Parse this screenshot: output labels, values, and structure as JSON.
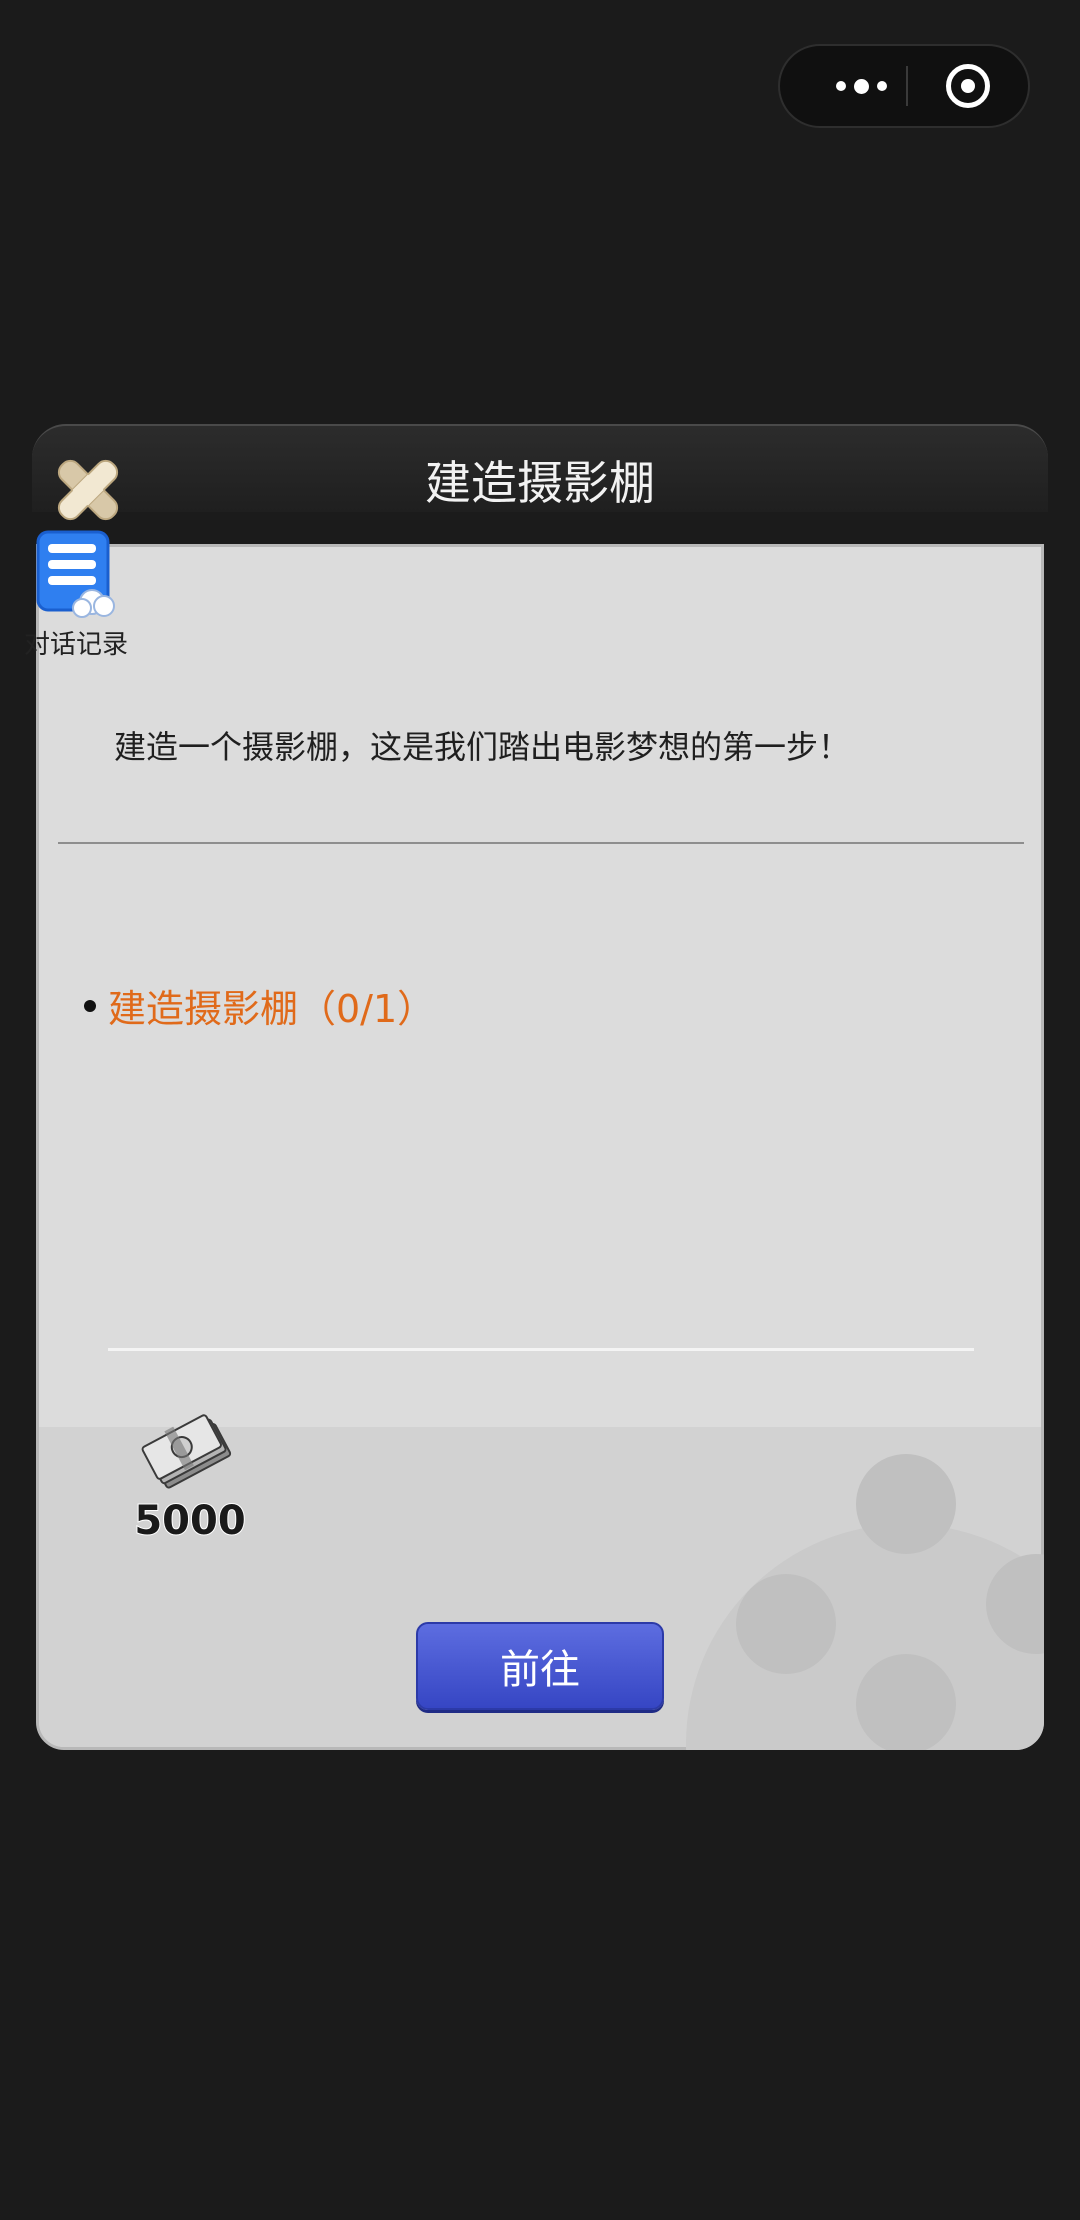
{
  "capsule": {
    "more_icon": "more-dots-icon",
    "close_icon": "target-circle-icon"
  },
  "dialog": {
    "title": "建造摄影棚",
    "close_icon": "close-x-icon",
    "chat_log": {
      "icon": "chat-log-icon",
      "label": "对话记录"
    },
    "description": "建造一个摄影棚，这是我们踏出电影梦想的第一步！",
    "objective": {
      "text": "建造摄影棚（0/1）",
      "color": "#e06a1a"
    },
    "reward": {
      "icon": "cash-stack-icon",
      "amount": "5000"
    },
    "action_button": {
      "label": "前往",
      "color": "#4a59d4"
    }
  }
}
